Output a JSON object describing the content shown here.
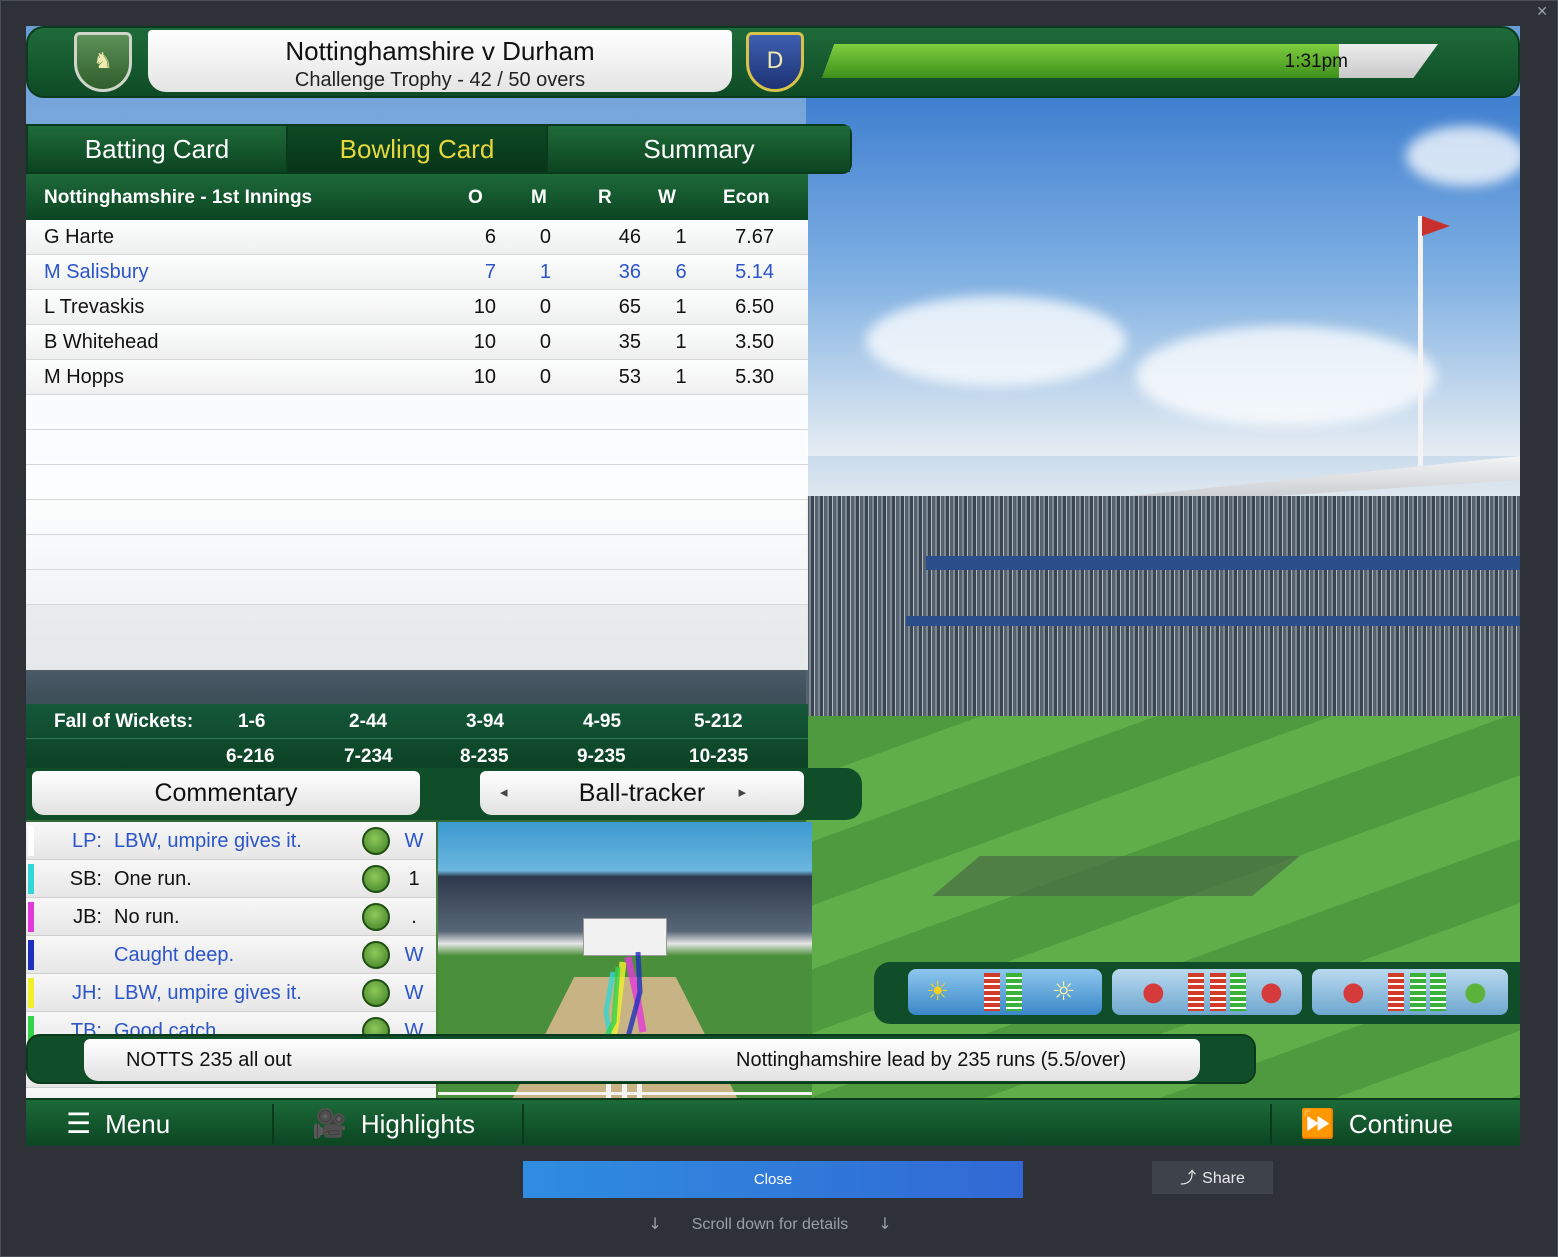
{
  "window": {
    "close_glyph": "✕"
  },
  "header": {
    "match_title": "Nottinghamshire v Durham",
    "match_subtitle": "Challenge Trophy - 42 / 50 overs",
    "time": "1:31pm",
    "time_progress": 0.84,
    "left_crest_icon": "stag-crest-icon",
    "right_crest_icon": "durham-crest-icon",
    "right_crest_letter": "D"
  },
  "tabs": {
    "batting": "Batting Card",
    "bowling": "Bowling Card",
    "summary": "Summary",
    "active": "bowling"
  },
  "bowling_card": {
    "innings_title": "Nottinghamshire - 1st Innings",
    "columns": {
      "o": "O",
      "m": "M",
      "r": "R",
      "w": "W",
      "econ": "Econ"
    },
    "rows": [
      {
        "name": "G Harte",
        "o": "6",
        "m": "0",
        "r": "46",
        "w": "1",
        "econ": "7.67",
        "highlight": false
      },
      {
        "name": "M Salisbury",
        "o": "7",
        "m": "1",
        "r": "36",
        "w": "6",
        "econ": "5.14",
        "highlight": true
      },
      {
        "name": "L Trevaskis",
        "o": "10",
        "m": "0",
        "r": "65",
        "w": "1",
        "econ": "6.50",
        "highlight": false
      },
      {
        "name": "B Whitehead",
        "o": "10",
        "m": "0",
        "r": "35",
        "w": "1",
        "econ": "3.50",
        "highlight": false
      },
      {
        "name": "M Hopps",
        "o": "10",
        "m": "0",
        "r": "53",
        "w": "1",
        "econ": "5.30",
        "highlight": false
      }
    ],
    "highlight_color": "#2b55c9"
  },
  "fall_of_wickets": {
    "label": "Fall of Wickets:",
    "line1": [
      "1-6",
      "2-44",
      "3-94",
      "4-95",
      "5-212"
    ],
    "line2": [
      "6-216",
      "7-234",
      "8-235",
      "9-235",
      "10-235"
    ]
  },
  "subtabs": {
    "commentary": "Commentary",
    "ball_tracker": "Ball-tracker",
    "prev_arrow": "◂",
    "next_arrow": "▸"
  },
  "commentary": [
    {
      "who": "LP:",
      "text": "LBW, umpire gives it.",
      "result": "W",
      "color": "#ffffff",
      "style": "blue"
    },
    {
      "who": "SB:",
      "text": "One run.",
      "result": "1",
      "color": "#33d6d6",
      "style": "dark"
    },
    {
      "who": "JB:",
      "text": "No run.",
      "result": ".",
      "color": "#e23ad8",
      "style": "dark"
    },
    {
      "who": "",
      "text": "Caught deep.",
      "result": "W",
      "color": "#1f2fbf",
      "style": "blue"
    },
    {
      "who": "JH:",
      "text": "LBW, umpire gives it.",
      "result": "W",
      "color": "#f0f02a",
      "style": "blue"
    },
    {
      "who": "TB:",
      "text": "Good catch.",
      "result": "W",
      "color": "#35d24a",
      "style": "blue"
    }
  ],
  "conditions": {
    "weather_icon": "sun-cloud-icon",
    "light_icon": "light-bulb-icon",
    "pitch_icon": "ball-pitch-icon",
    "swing_icon": "ball-swing-icon",
    "seam_icon": "ball-seam-icon",
    "ball_icon": "ball-condition-icon"
  },
  "status": {
    "score": "NOTTS  235 all out",
    "lead": "Nottinghamshire lead by 235 runs (5.5/over)"
  },
  "bottom_bar": {
    "menu": "Menu",
    "highlights": "Highlights",
    "continue": "Continue"
  },
  "viewer": {
    "close": "Close",
    "share": "Share",
    "scroll_hint": "Scroll down for details"
  }
}
